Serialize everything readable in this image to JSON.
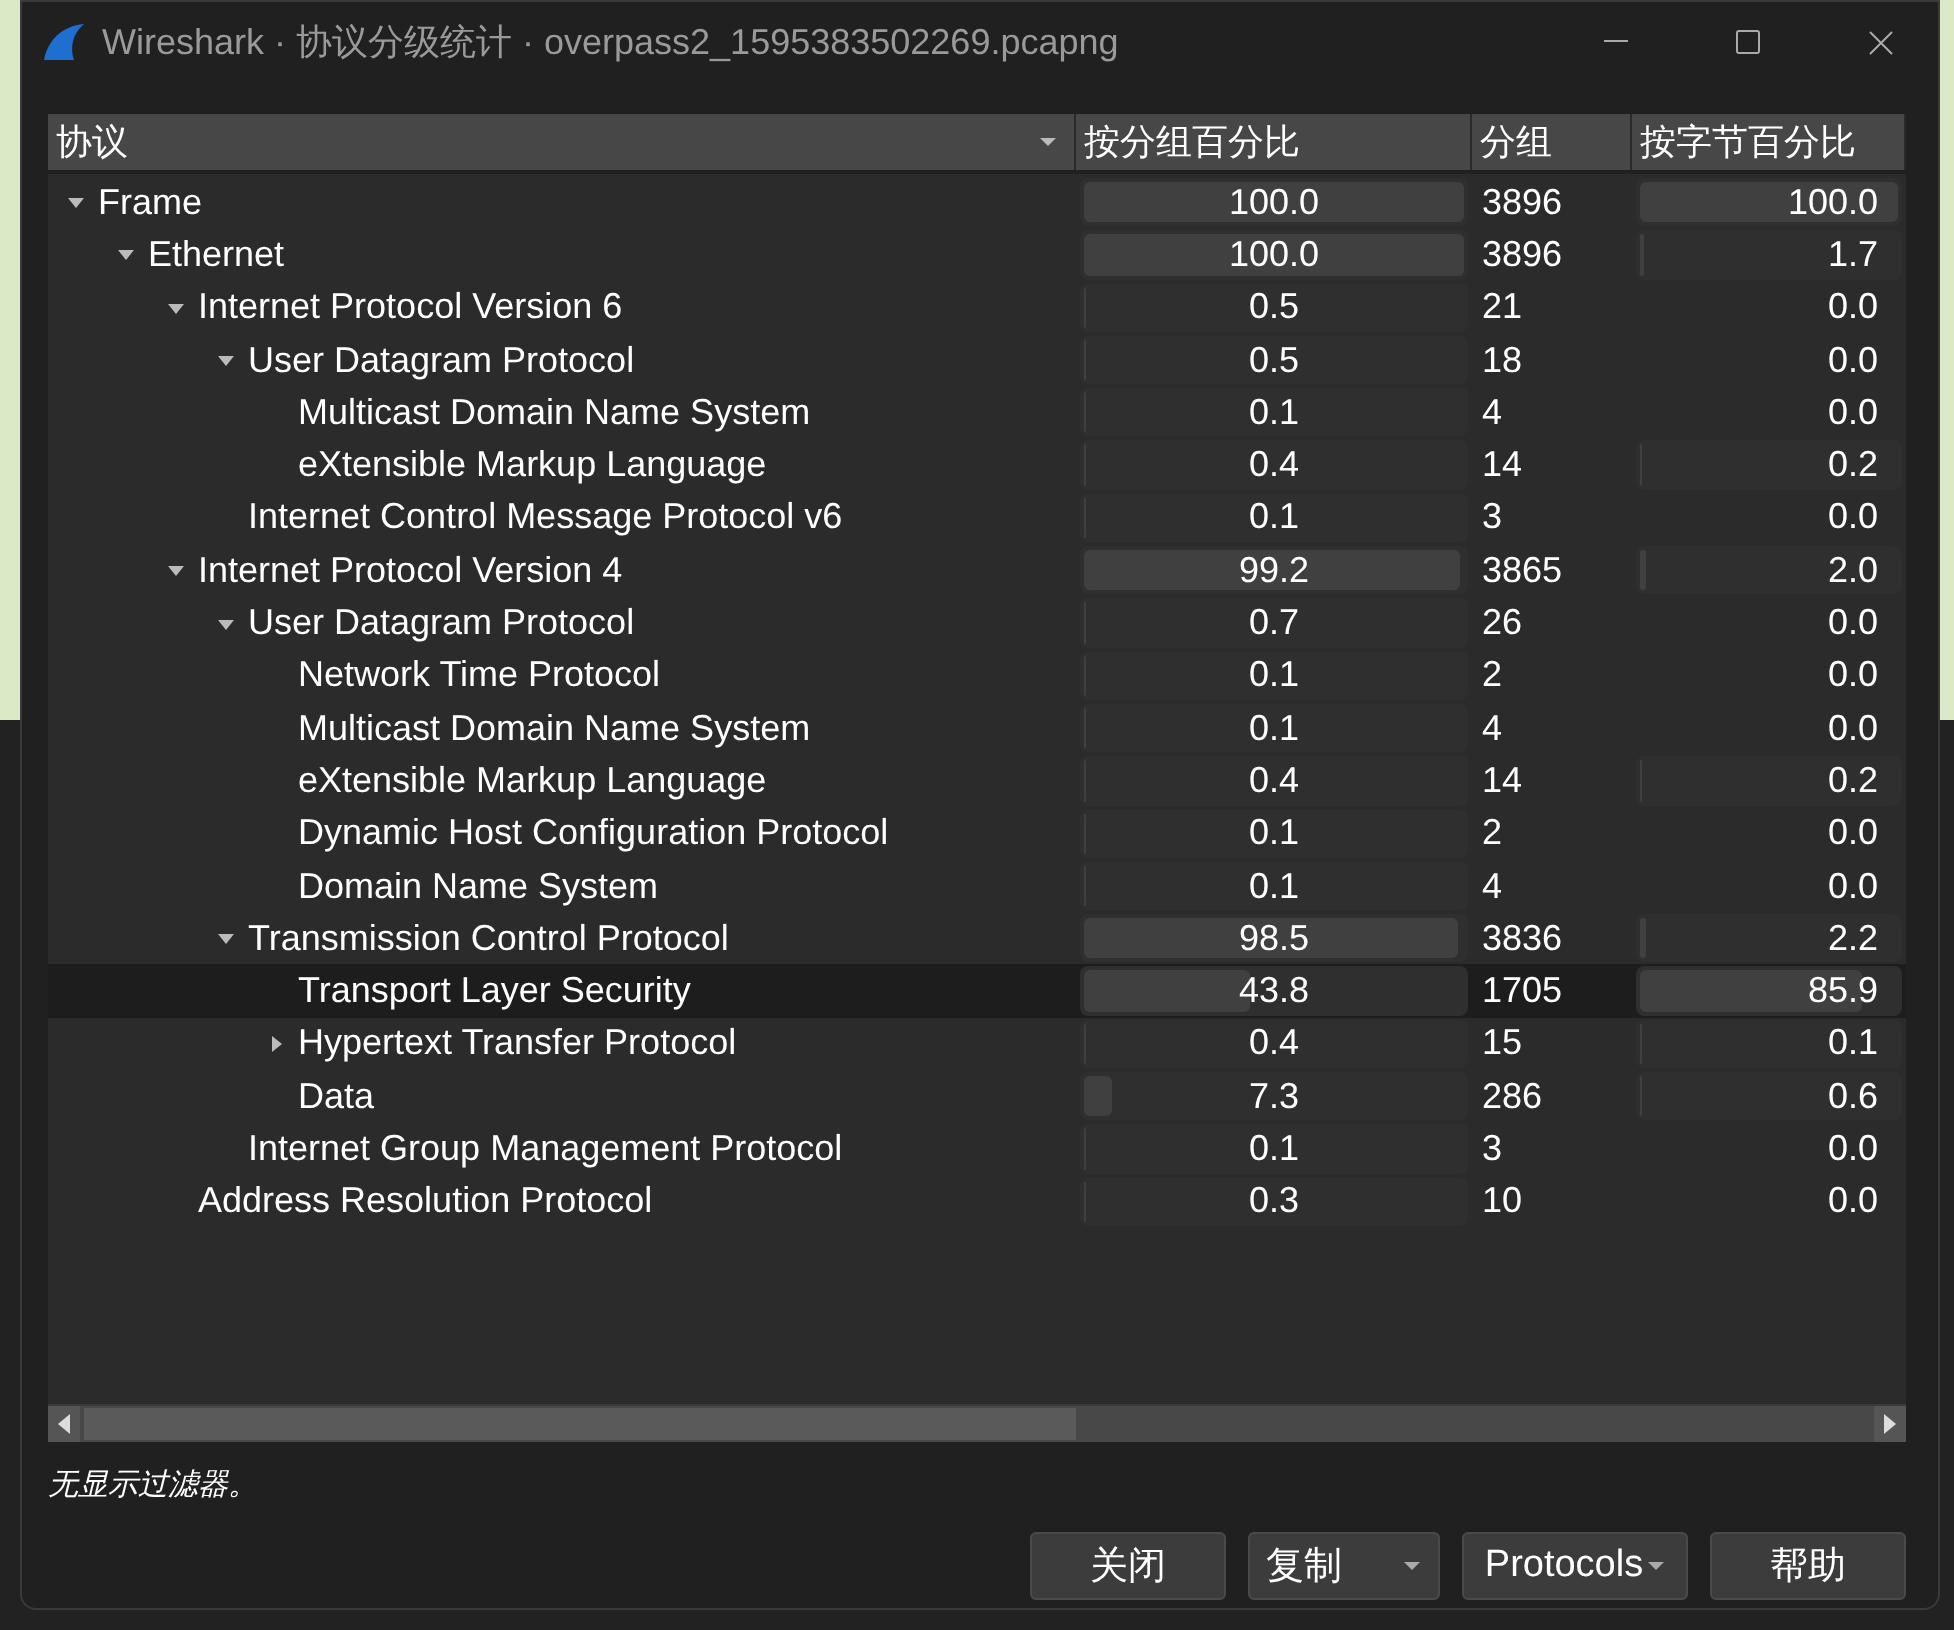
{
  "window": {
    "title": "Wireshark · 协议分级统计 · overpass2_1595383502269.pcapng"
  },
  "table": {
    "columns": [
      {
        "label": "协议",
        "sorted": true
      },
      {
        "label": "按分组百分比",
        "sorted": false
      },
      {
        "label": "分组",
        "sorted": false
      },
      {
        "label": "按字节百分比",
        "sorted": false
      }
    ],
    "rows": [
      {
        "name": "Frame",
        "expanded": true,
        "selected": false,
        "packet_percent": {
          "text": "100.0",
          "level": 1.0
        },
        "packets": "3896",
        "byte_percent": {
          "text": "100.0",
          "level": 1.0
        },
        "children": [
          {
            "name": "Ethernet",
            "expanded": true,
            "selected": false,
            "packet_percent": {
              "text": "100.0",
              "level": 1.0
            },
            "packets": "3896",
            "byte_percent": {
              "text": "1.7",
              "level": 0.017
            },
            "children": [
              {
                "name": "Internet Protocol Version 6",
                "expanded": true,
                "selected": false,
                "packet_percent": {
                  "text": "0.5",
                  "level": 0.005
                },
                "packets": "21",
                "byte_percent": {
                  "text": "0.0"
                },
                "children": [
                  {
                    "name": "User Datagram Protocol",
                    "expanded": true,
                    "selected": false,
                    "packet_percent": {
                      "text": "0.5",
                      "level": 0.005
                    },
                    "packets": "18",
                    "byte_percent": {
                      "text": "0.0"
                    },
                    "children": [
                      {
                        "name": "Multicast Domain Name System",
                        "selected": false,
                        "packet_percent": {
                          "text": "0.1",
                          "level": 0.001
                        },
                        "packets": "4",
                        "byte_percent": {
                          "text": "0.0"
                        }
                      },
                      {
                        "name": "eXtensible Markup Language",
                        "selected": false,
                        "packet_percent": {
                          "text": "0.4",
                          "level": 0.004
                        },
                        "packets": "14",
                        "byte_percent": {
                          "text": "0.2",
                          "level": 0.002
                        }
                      }
                    ]
                  },
                  {
                    "name": "Internet Control Message Protocol v6",
                    "selected": false,
                    "packet_percent": {
                      "text": "0.1",
                      "level": 0.001
                    },
                    "packets": "3",
                    "byte_percent": {
                      "text": "0.0"
                    }
                  }
                ]
              },
              {
                "name": "Internet Protocol Version 4",
                "expanded": true,
                "selected": false,
                "packet_percent": {
                  "text": "99.2",
                  "level": 0.992
                },
                "packets": "3865",
                "byte_percent": {
                  "text": "2.0",
                  "level": 0.02
                },
                "children": [
                  {
                    "name": "User Datagram Protocol",
                    "expanded": true,
                    "selected": false,
                    "packet_percent": {
                      "text": "0.7",
                      "level": 0.007
                    },
                    "packets": "26",
                    "byte_percent": {
                      "text": "0.0"
                    },
                    "children": [
                      {
                        "name": "Network Time Protocol",
                        "selected": false,
                        "packet_percent": {
                          "text": "0.1",
                          "level": 0.001
                        },
                        "packets": "2",
                        "byte_percent": {
                          "text": "0.0"
                        }
                      },
                      {
                        "name": "Multicast Domain Name System",
                        "selected": false,
                        "packet_percent": {
                          "text": "0.1",
                          "level": 0.001
                        },
                        "packets": "4",
                        "byte_percent": {
                          "text": "0.0"
                        }
                      },
                      {
                        "name": "eXtensible Markup Language",
                        "selected": false,
                        "packet_percent": {
                          "text": "0.4",
                          "level": 0.004
                        },
                        "packets": "14",
                        "byte_percent": {
                          "text": "0.2",
                          "level": 0.002
                        }
                      },
                      {
                        "name": "Dynamic Host Configuration Protocol",
                        "selected": false,
                        "packet_percent": {
                          "text": "0.1",
                          "level": 0.001
                        },
                        "packets": "2",
                        "byte_percent": {
                          "text": "0.0"
                        }
                      },
                      {
                        "name": "Domain Name System",
                        "selected": false,
                        "packet_percent": {
                          "text": "0.1",
                          "level": 0.001
                        },
                        "packets": "4",
                        "byte_percent": {
                          "text": "0.0"
                        }
                      }
                    ]
                  },
                  {
                    "name": "Transmission Control Protocol",
                    "expanded": true,
                    "selected": false,
                    "packet_percent": {
                      "text": "98.5",
                      "level": 0.985
                    },
                    "packets": "3836",
                    "byte_percent": {
                      "text": "2.2",
                      "level": 0.022
                    },
                    "children": [
                      {
                        "name": "Transport Layer Security",
                        "selected": true,
                        "packet_percent": {
                          "text": "43.8",
                          "level": 0.438
                        },
                        "packets": "1705",
                        "byte_percent": {
                          "text": "85.9",
                          "level": 0.859
                        }
                      },
                      {
                        "name": "Hypertext Transfer Protocol",
                        "expanded": false,
                        "selected": false,
                        "packet_percent": {
                          "text": "0.4",
                          "level": 0.004
                        },
                        "packets": "15",
                        "byte_percent": {
                          "text": "0.1",
                          "level": 0.001
                        }
                      },
                      {
                        "name": "Data",
                        "selected": false,
                        "packet_percent": {
                          "text": "7.3",
                          "level": 0.073
                        },
                        "packets": "286",
                        "byte_percent": {
                          "text": "0.6",
                          "level": 0.006
                        }
                      }
                    ]
                  },
                  {
                    "name": "Internet Group Management Protocol",
                    "selected": false,
                    "packet_percent": {
                      "text": "0.1",
                      "level": 0.001
                    },
                    "packets": "3",
                    "byte_percent": {
                      "text": "0.0"
                    }
                  }
                ]
              },
              {
                "name": "Address Resolution Protocol",
                "selected": false,
                "packet_percent": {
                  "text": "0.3",
                  "level": 0.003
                },
                "packets": "10",
                "byte_percent": {
                  "text": "0.0"
                }
              }
            ]
          }
        ]
      }
    ]
  },
  "status": "无显示过滤器。",
  "buttons": [
    {
      "label": "关闭",
      "kind": "plain"
    },
    {
      "label": "复制",
      "kind": "split"
    },
    {
      "label": "Protocols",
      "kind": "menu"
    },
    {
      "label": "帮助",
      "kind": "plain"
    }
  ]
}
